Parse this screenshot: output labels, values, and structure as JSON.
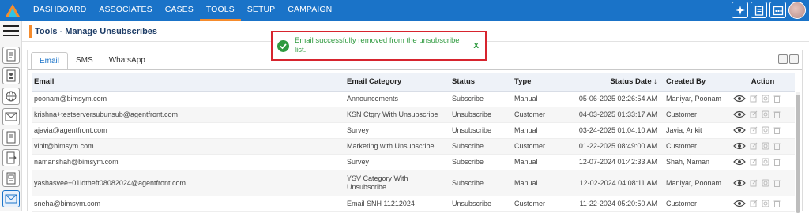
{
  "nav": {
    "items": [
      "DASHBOARD",
      "ASSOCIATES",
      "CASES",
      "TOOLS",
      "SETUP",
      "CAMPAIGN"
    ],
    "active": "TOOLS"
  },
  "colors": {
    "topbar": "#1a73c8",
    "accent": "#f58b2c",
    "success": "#2f9a3f",
    "alert_border": "#d7242e"
  },
  "page": {
    "title": "Tools - Manage Unsubscribes"
  },
  "toast": {
    "message": "Email successfully removed from the unsubscribe list.",
    "close": "X"
  },
  "tabs": [
    "Email",
    "SMS",
    "WhatsApp"
  ],
  "table": {
    "headers": [
      "Email",
      "Email Category",
      "Status",
      "Type",
      "Status Date",
      "Created By",
      "Action"
    ],
    "sort_indicator": "↓",
    "rows": [
      [
        "poonam@bimsym.com",
        "Announcements",
        "Subscribe",
        "Manual",
        "05-06-2025 02:26:54 AM",
        "Maniyar, Poonam"
      ],
      [
        "krishna+testserversubunsub@agentfront.com",
        "KSN Ctgry With Unsubscribe",
        "Unsubscribe",
        "Customer",
        "04-03-2025 01:33:17 AM",
        "Customer"
      ],
      [
        "ajavia@agentfront.com",
        "Survey",
        "Unsubscribe",
        "Manual",
        "03-24-2025 01:04:10 AM",
        "Javia, Ankit"
      ],
      [
        "vinit@bimsym.com",
        "Marketing with Unsubscribe",
        "Subscribe",
        "Customer",
        "01-22-2025 08:49:00 AM",
        "Customer"
      ],
      [
        "namanshah@bimsym.com",
        "Survey",
        "Subscribe",
        "Manual",
        "12-07-2024 01:42:33 AM",
        "Shah, Naman"
      ],
      [
        "yashasvee+01idtheft08082024@agentfront.com",
        "YSV Category With Unsubscribe",
        "Subscribe",
        "Manual",
        "12-02-2024 04:08:11 AM",
        "Maniyar, Poonam"
      ],
      [
        "sneha@bimsym.com",
        "Email SNH 11212024",
        "Unsubscribe",
        "Customer",
        "11-22-2024 05:20:50 AM",
        "Customer"
      ]
    ]
  },
  "icons": {
    "row_actions": [
      "eye-icon",
      "edit-icon",
      "copy-icon",
      "delete-icon"
    ],
    "sidebar": [
      "document-icon",
      "contact-card-icon",
      "globe-icon",
      "mail-icon",
      "document-icon",
      "document-export-icon",
      "report-icon",
      "mail-active-icon"
    ]
  }
}
